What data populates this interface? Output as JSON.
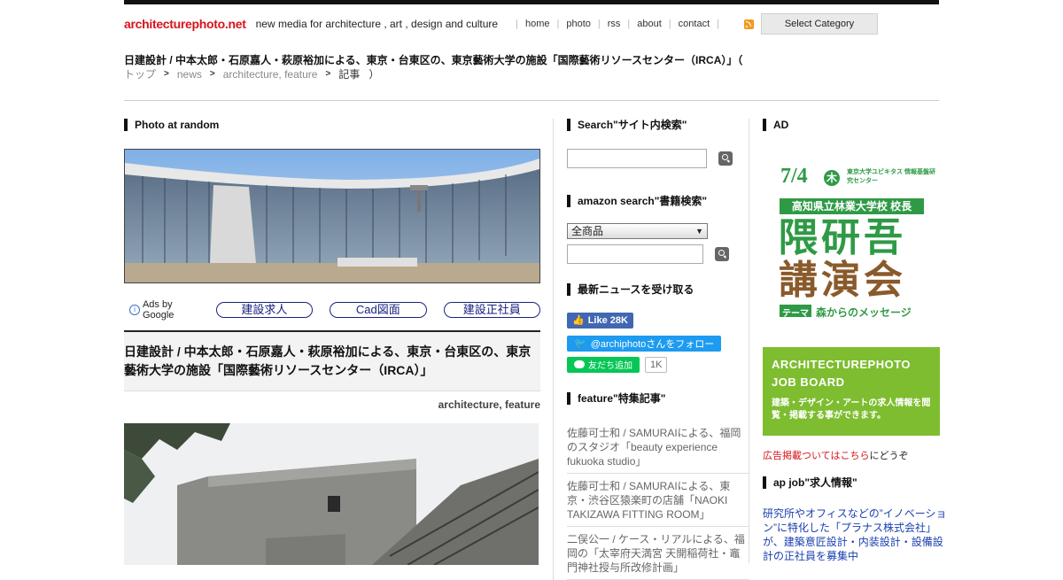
{
  "header": {
    "logo": "architecturephoto.net",
    "tagline": "new media for architecture , art , design and culture",
    "nav": [
      "home",
      "photo",
      "rss",
      "about",
      "contact"
    ],
    "category_select": "Select Category"
  },
  "breadcrumb": {
    "title": "日建設計 / 中本太郎・石原嘉人・萩原裕加による、東京・台東区の、東京藝術大学の施設「国際藝術リソースセンター（IRCA）」（",
    "items": [
      "トップ",
      "news",
      "architecture",
      "feature",
      "記事"
    ],
    "close": "）"
  },
  "main": {
    "photo_heading": "Photo at random",
    "ads_by": "Ads by Google",
    "ad_buttons": [
      "建設求人",
      "Cad図面",
      "建設正社員"
    ],
    "post_title": "日建設計 / 中本太郎・石原嘉人・萩原裕加による、東京・台東区の、東京藝術大学の施設「国際藝術リソースセンター（IRCA）」",
    "post_tag_1": "architecture",
    "post_tag_2": "feature"
  },
  "sidebar": {
    "search_heading": "Search\"サイト内検索\"",
    "amazon_heading": "amazon search\"書籍検索\"",
    "amazon_select": "全商品",
    "news_heading": "最新ニュースを受け取る",
    "fb_like": "Like",
    "fb_count": "28K",
    "twitter_follow": "@archiphotoさんをフォロー",
    "line_add": "友だち追加",
    "line_count": "1K",
    "feature_heading": "feature\"特集記事\"",
    "feature_items": [
      "佐藤可士和 / SAMURAIによる、福岡のスタジオ「beauty experience fukuoka studio」",
      "佐藤可士和 / SAMURAIによる、東京・渋谷区猿楽町の店舗「NAOKI TAKIZAWA FITTING ROOM」",
      "二俣公一 / ケース・リアルによる、福岡の「太宰府天満宮 天開稲荷社・竈門神社授与所改修計画」"
    ]
  },
  "right": {
    "ad_heading": "AD",
    "banner": {
      "date": "7/4",
      "weekday": "木",
      "org": "東京大学ユビキタス 情報基盤研究センター",
      "speaker_title": "高知県立林業大学校 校長",
      "speaker": "隈研吾",
      "event": "講演会",
      "theme_label": "テーマ",
      "theme": "森からのメッセージ"
    },
    "job_board_title_1": "ARCHITECTUREPHOTO",
    "job_board_title_2": "JOB BOARD",
    "job_board_desc": "建築・デザイン・アートの求人情報を閲覧・掲載する事ができます。",
    "ad_note_link": "広告掲載ついてはこちら",
    "ad_note_rest": "にどうぞ",
    "apjob_heading": "ap job\"求人情報\"",
    "apjob_text": "研究所やオフィスなどの”イノベーション”に特化した「プラナス株式会社」が、建築意匠設計・内装設計・設備設計の正社員を募集中"
  },
  "colors": {
    "logo_red": "#d7141a",
    "job_green": "#7dbd2f",
    "banner_green": "#2f9a46",
    "link_blue": "#1a3fb0"
  }
}
